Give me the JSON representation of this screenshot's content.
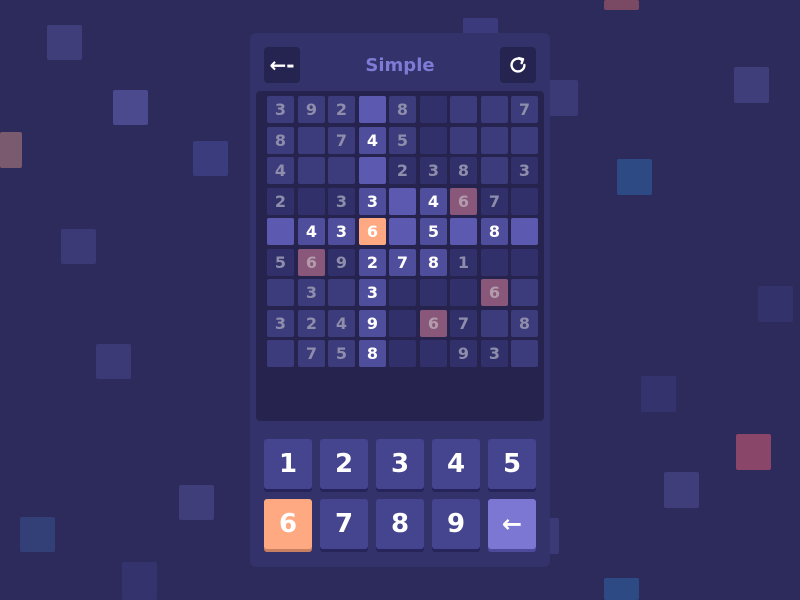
{
  "header": {
    "title": "Simple",
    "back_icon": "arrow-left-icon",
    "reset_icon": "refresh-icon"
  },
  "board": {
    "rows": [
      [
        "3",
        "9",
        "2",
        "",
        "8",
        "",
        "",
        "",
        "7"
      ],
      [
        "8",
        "",
        "7",
        "4",
        "5",
        "",
        "",
        "",
        ""
      ],
      [
        "4",
        "",
        "",
        "",
        "2",
        "3",
        "8",
        "",
        "3"
      ],
      [
        "2",
        "",
        "3",
        "3",
        "",
        "4",
        "6",
        "7",
        ""
      ],
      [
        "",
        "4",
        "3",
        "6",
        "",
        "5",
        "",
        "8",
        ""
      ],
      [
        "5",
        "6",
        "9",
        "2",
        "7",
        "8",
        "1",
        "",
        ""
      ],
      [
        "",
        "3",
        "",
        "3",
        "",
        "",
        "",
        "6",
        ""
      ],
      [
        "3",
        "2",
        "4",
        "9",
        "",
        "6",
        "7",
        "",
        "8"
      ],
      [
        "",
        "7",
        "5",
        "8",
        "",
        "",
        "9",
        "3",
        ""
      ]
    ],
    "styles": [
      [
        "g",
        "g",
        "g",
        "r",
        "g",
        "d",
        "g",
        "g",
        "g"
      ],
      [
        "g",
        "g",
        "g",
        "u",
        "g",
        "d",
        "g",
        "g",
        "g"
      ],
      [
        "g",
        "g",
        "g",
        "r",
        "d",
        "d",
        "d",
        "g",
        "d"
      ],
      [
        "d",
        "d",
        "d",
        "u",
        "r",
        "u",
        "e",
        "d",
        "d"
      ],
      [
        "r",
        "u",
        "u",
        "s",
        "r",
        "u",
        "r",
        "u",
        "r"
      ],
      [
        "d",
        "e",
        "d",
        "u",
        "u",
        "u",
        "d",
        "d",
        "d"
      ],
      [
        "g",
        "g",
        "g",
        "u",
        "d",
        "d",
        "d",
        "e",
        "g"
      ],
      [
        "g",
        "g",
        "g",
        "u",
        "d",
        "e",
        "d",
        "g",
        "g"
      ],
      [
        "g",
        "g",
        "g",
        "u",
        "d",
        "d",
        "d",
        "d",
        "g"
      ]
    ]
  },
  "keypad": {
    "keys": [
      "1",
      "2",
      "3",
      "4",
      "5",
      "6",
      "7",
      "8",
      "9",
      "←"
    ],
    "selected": "6"
  },
  "colors": {
    "accent": "#ffa982",
    "title": "#7e7bd6",
    "background": "#2d2b5c"
  }
}
